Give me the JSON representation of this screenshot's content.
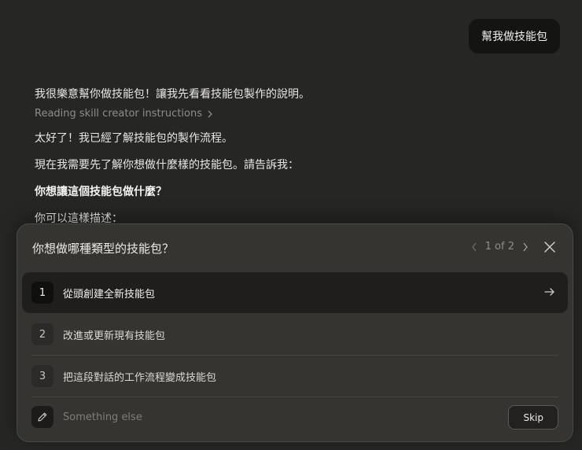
{
  "user_message": "幫我做技能包",
  "assistant": {
    "intro": "我很樂意幫你做技能包！讓我先看看技能包製作的說明。",
    "tool_call": "Reading skill creator instructions",
    "p1": "太好了！我已經了解技能包的製作流程。",
    "p2": "現在我需要先了解你想做什麼樣的技能包。請告訴我：",
    "p3_bold": "你想讓這個技能包做什麼？",
    "p4": "你可以這樣描述："
  },
  "question_panel": {
    "title": "你想做哪種類型的技能包？",
    "pager": "1 of 2",
    "options": [
      {
        "number": "1",
        "label": "從頭創建全新技能包"
      },
      {
        "number": "2",
        "label": "改進或更新現有技能包"
      },
      {
        "number": "3",
        "label": "把這段對話的工作流程變成技能包"
      }
    ],
    "other_placeholder": "Something else",
    "skip_label": "Skip"
  },
  "colors": {
    "background": "#262624",
    "panel": "#363532",
    "active_option": "#1f1e1d",
    "text": "#ececea",
    "muted": "#8f8d87"
  },
  "icons": [
    "chevron-right-icon",
    "chevron-left-icon",
    "close-icon",
    "arrow-right-icon",
    "pencil-icon"
  ]
}
